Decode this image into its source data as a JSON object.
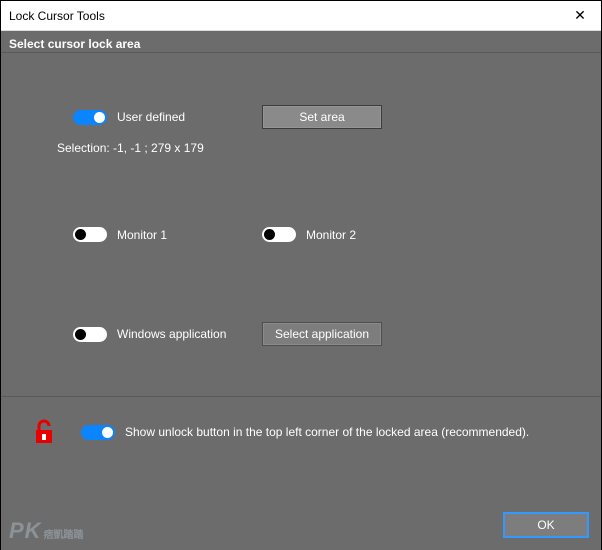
{
  "window": {
    "title": "Lock Cursor Tools",
    "close_glyph": "✕"
  },
  "header": {
    "title": "Select cursor lock area"
  },
  "options": {
    "user_defined": {
      "label": "User defined",
      "on": true,
      "button": "Set area"
    },
    "selection_text": "Selection: -1, -1 ;  279 x 179",
    "monitor1": {
      "label": "Monitor 1",
      "on": false
    },
    "monitor2": {
      "label": "Monitor 2",
      "on": false
    },
    "windows_app": {
      "label": "Windows application",
      "on": false,
      "button": "Select application"
    },
    "show_unlock": {
      "label": "Show unlock button in the top left corner of the locked area (recommended).",
      "on": true
    }
  },
  "footer": {
    "ok": "OK"
  },
  "watermark": {
    "big": "PK",
    "small": "痞凱踏踏"
  },
  "colors": {
    "accent": "#0a84ff",
    "bg": "#6c6c6c"
  }
}
